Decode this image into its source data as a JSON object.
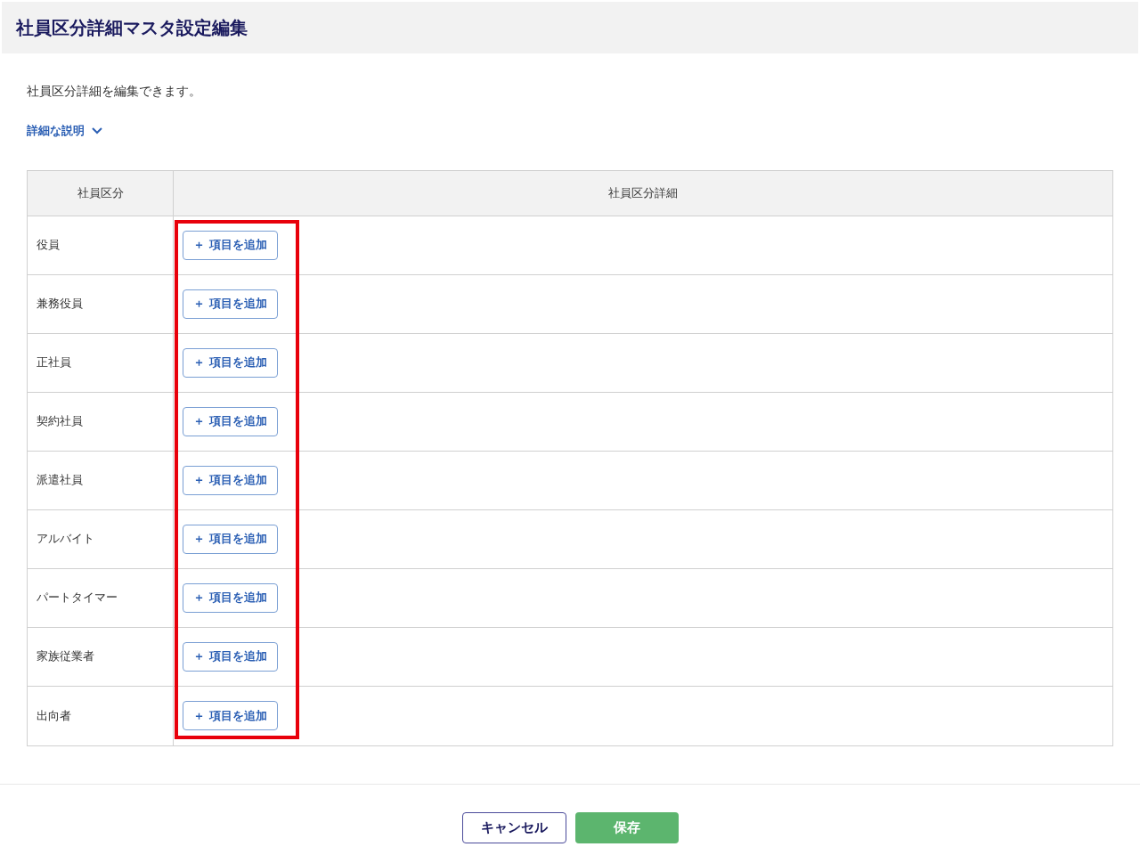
{
  "header": {
    "title": "社員区分詳細マスタ設定編集"
  },
  "description": "社員区分詳細を編集できます。",
  "details_toggle": {
    "label": "詳細な説明",
    "expanded": false
  },
  "table": {
    "columns": [
      "社員区分",
      "社員区分詳細"
    ],
    "rows": [
      {
        "category": "役員",
        "add_button": "＋ 項目を追加"
      },
      {
        "category": "兼務役員",
        "add_button": "＋ 項目を追加"
      },
      {
        "category": "正社員",
        "add_button": "＋ 項目を追加"
      },
      {
        "category": "契約社員",
        "add_button": "＋ 項目を追加"
      },
      {
        "category": "派遣社員",
        "add_button": "＋ 項目を追加"
      },
      {
        "category": "アルバイト",
        "add_button": "＋ 項目を追加"
      },
      {
        "category": "パートタイマー",
        "add_button": "＋ 項目を追加"
      },
      {
        "category": "家族従業者",
        "add_button": "＋ 項目を追加"
      },
      {
        "category": "出向者",
        "add_button": "＋ 項目を追加"
      }
    ]
  },
  "footer": {
    "cancel": "キャンセル",
    "save": "保存"
  }
}
